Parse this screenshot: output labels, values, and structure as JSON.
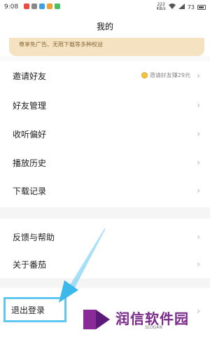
{
  "status_bar": {
    "time": "9:08",
    "speed_top": "222",
    "speed_bottom": "KB/s",
    "battery": "73"
  },
  "header": {
    "title": "我的"
  },
  "banner": {
    "text": "尊享免广告、无限下载等多种权益"
  },
  "menu": {
    "invite_label": "邀请好友",
    "invite_extra": "邀请好友赚29元",
    "friends_label": "好友管理",
    "prefs_label": "收听偏好",
    "history_label": "播放历史",
    "downloads_label": "下载记录",
    "feedback_label": "反馈与帮助",
    "about_label": "关于番茄",
    "logout_label": "退出登录",
    "chevron": "›"
  },
  "watermark": {
    "brand": "润信软件园",
    "slogan": "SLOGAN"
  },
  "colors": {
    "highlight": "#5ec8f0",
    "banner_bg": "#f4e2c0",
    "watermark_brand": "#7a2a8a"
  }
}
